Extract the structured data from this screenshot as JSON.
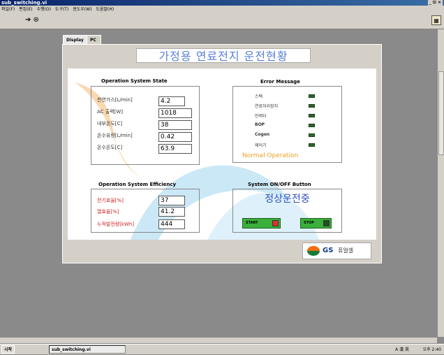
{
  "window": {
    "title": "sub_switching.vi",
    "controls": "_ ⊡ ×"
  },
  "menu": [
    "파일(F)",
    "편집(E)",
    "수행(O)",
    "도구(T)",
    "윈도우(W)",
    "도움말(H)"
  ],
  "tabs": {
    "display": "Display",
    "pc_set": "PC set"
  },
  "banner": "가정용 연료전지 운전현황",
  "operation_state": {
    "title": "Operation System  State",
    "rows": [
      {
        "label": "천연가스[L/min]",
        "value": "4.2"
      },
      {
        "label": "AC 출력[W]",
        "value": "1018"
      },
      {
        "label": "내부온도[C]",
        "value": "38"
      },
      {
        "label": "온수유량[L/min]",
        "value": "0.42"
      },
      {
        "label": "온수온도[C]",
        "value": "63.9"
      }
    ]
  },
  "error_message": {
    "title": "Error Message",
    "items": [
      "스택",
      "연료처리장치",
      "인버터",
      "BOP",
      "Cogen",
      "제어기"
    ],
    "status": "Normal Operation"
  },
  "efficiency": {
    "title": "Operation System Efficiency",
    "rows": [
      {
        "label": "전기효율[%]",
        "value": "37"
      },
      {
        "label": "열효율[%]",
        "value": "41.2"
      },
      {
        "label": "누적발전량[kWh]",
        "value": "444"
      }
    ]
  },
  "onoff": {
    "title": "System ON/OFF Button",
    "status": "정상운전중",
    "start": "START",
    "stop": "STOP"
  },
  "logo": {
    "gs": "GS",
    "text": "퓨얼셀"
  },
  "taskbar": {
    "start": "시작",
    "task": "sub_switching.vi",
    "tray": "A 漢 英",
    "clock": "오후 2:40"
  },
  "colors": {
    "led_on": "#2a6a2a",
    "start_ind": "#e03030",
    "stop_ind": "#205020",
    "status_normal": "#f0a020"
  }
}
